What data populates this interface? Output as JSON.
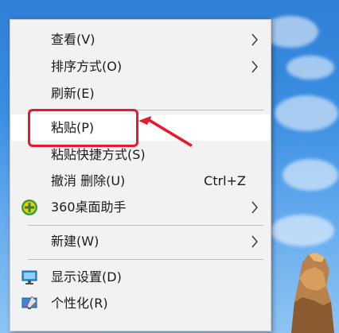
{
  "menu": {
    "items": [
      {
        "label": "查看(V)",
        "submenu": true
      },
      {
        "label": "排序方式(O)",
        "submenu": true
      },
      {
        "label": "刷新(E)"
      },
      {
        "label": "粘贴(P)"
      },
      {
        "label": "粘贴快捷方式(S)"
      },
      {
        "label": "撤消 删除(U)",
        "shortcut": "Ctrl+Z"
      },
      {
        "label": "360桌面助手",
        "icon": "360-assistant-icon",
        "submenu": true
      },
      {
        "label": "新建(W)",
        "submenu": true
      },
      {
        "label": "显示设置(D)",
        "icon": "display-settings-icon"
      },
      {
        "label": "个性化(R)",
        "icon": "personalize-icon"
      }
    ]
  },
  "annotation": {
    "color": "#e8192c"
  }
}
